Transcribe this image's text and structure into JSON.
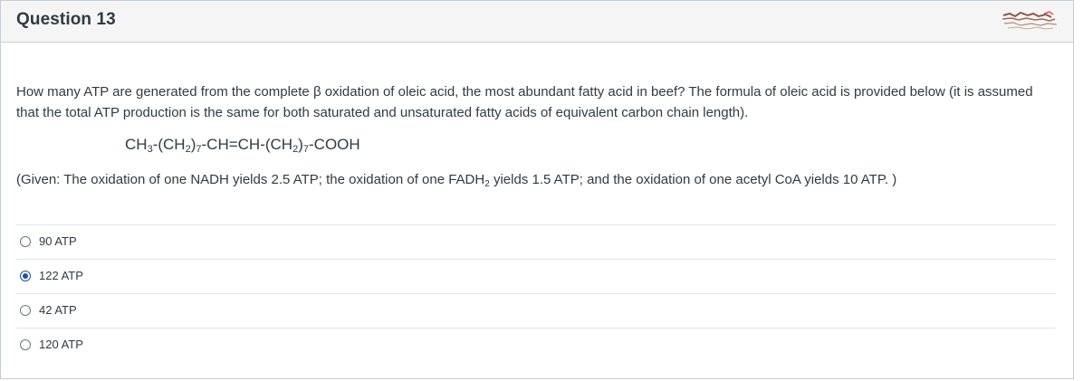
{
  "question": {
    "title": "Question 13",
    "text": "How many ATP are generated from the complete β oxidation of oleic acid, the most abundant fatty acid in beef? The formula of oleic acid is provided below (it is assumed that the total ATP production is the same for both saturated and unsaturated fatty acids of equivalent carbon chain length).",
    "formula": {
      "part1": "CH",
      "sub1": "3",
      "part2": "-(CH",
      "sub2": "2",
      "part3": ")",
      "sub3": "7",
      "part4": "-CH=CH-(CH",
      "sub4": "2",
      "part5": ")",
      "sub5": "7",
      "part6": "-COOH"
    },
    "given": {
      "part1": "(Given: The oxidation of one NADH yields 2.5 ATP; the oxidation of one FADH",
      "sub": "2",
      "part2": " yields 1.5 ATP; and the oxidation of one acetyl CoA yields 10 ATP. )"
    }
  },
  "answers": [
    {
      "label": "90 ATP",
      "selected": false
    },
    {
      "label": "122 ATP",
      "selected": true
    },
    {
      "label": "42 ATP",
      "selected": false
    },
    {
      "label": "120 ATP",
      "selected": false
    }
  ],
  "colors": {
    "header_bg": "#f5f5f5",
    "border": "#c7cdd1",
    "text": "#2d3b45",
    "radio_selected": "#1f4fa8"
  }
}
